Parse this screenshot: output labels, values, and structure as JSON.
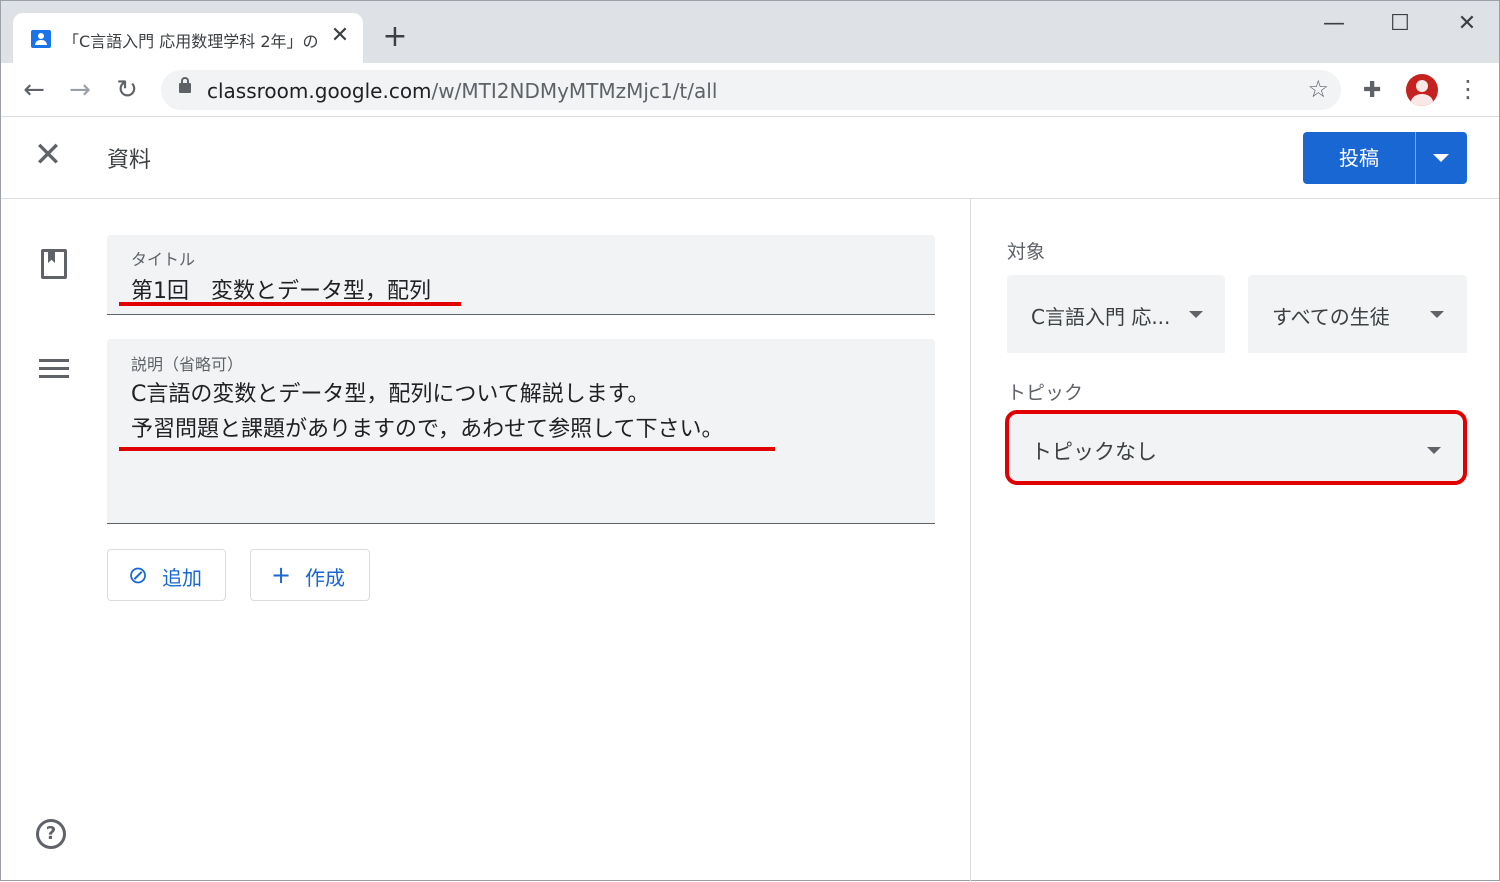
{
  "browser": {
    "tab_title": "「C言語入門 応用数理学科 2年」の",
    "tab_close": "✕",
    "new_tab": "+",
    "minimize": "—",
    "maximize": "☐",
    "close": "✕",
    "back": "←",
    "forward": "→",
    "reload": "↻",
    "url_host": "classroom.google.com",
    "url_path": "/w/MTI2NDMyMTMzMjc1/t/all",
    "star": "☆",
    "extensions": "✚",
    "menu": "⋮"
  },
  "header": {
    "close_label": "✕",
    "title": "資料",
    "post_label": "投稿"
  },
  "form": {
    "title_label": "タイトル",
    "title_value": "第1回　変数とデータ型，配列",
    "desc_label": "説明（省略可）",
    "desc_line1": "C言語の変数とデータ型，配列について解説します。",
    "desc_line2": "予習問題と課題がありますので，あわせて参照して下さい。",
    "attach_icon": "⊘",
    "attach_label": "追加",
    "create_icon": "+",
    "create_label": "作成",
    "help": "?"
  },
  "sidebar": {
    "target_label": "対象",
    "class_select": "C言語入門 応...",
    "students_select": "すべての生徒",
    "topic_label": "トピック",
    "topic_select": "トピックなし"
  },
  "annotations": {
    "highlight_color": "#e00000"
  }
}
